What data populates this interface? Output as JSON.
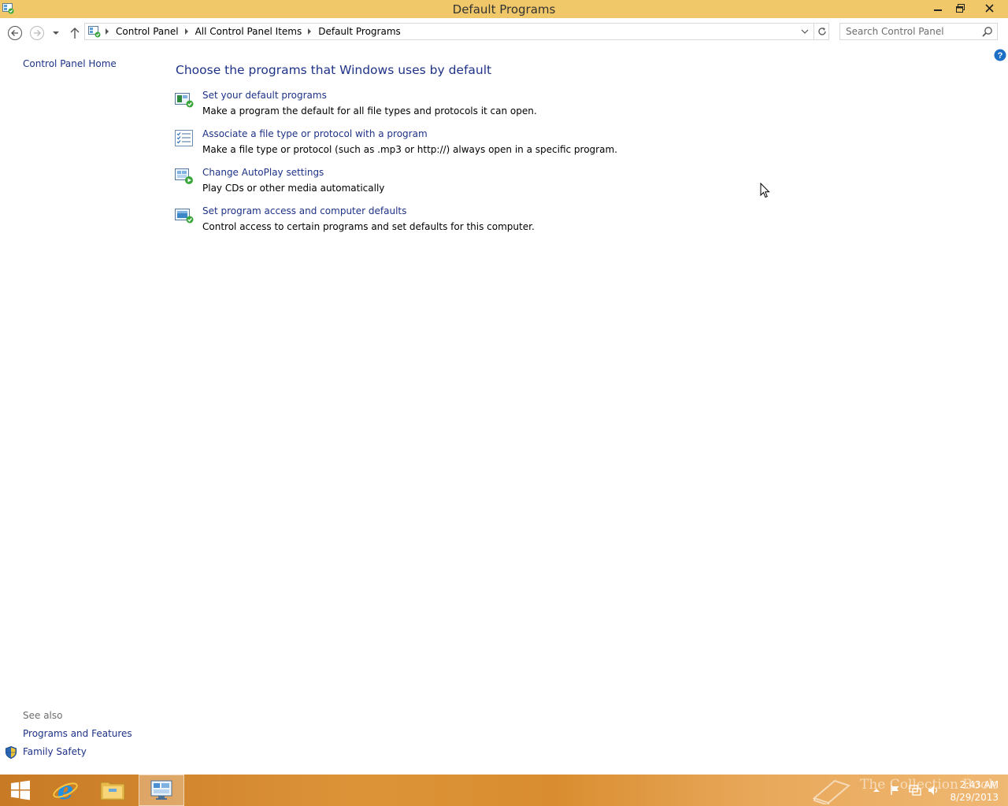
{
  "window": {
    "title": "Default Programs"
  },
  "nav": {
    "breadcrumbs": [
      "Control Panel",
      "All Control Panel Items",
      "Default Programs"
    ],
    "search_placeholder": "Search Control Panel"
  },
  "left_pane": {
    "home_link": "Control Panel Home",
    "see_also_title": "See also",
    "see_also_links": [
      "Programs and Features",
      "Family Safety"
    ]
  },
  "main": {
    "heading": "Choose the programs that Windows uses by default",
    "tasks": [
      {
        "icon": "default-programs-icon",
        "link": "Set your default programs",
        "description": "Make a program the default for all file types and protocols it can open."
      },
      {
        "icon": "file-association-icon",
        "link": "Associate a file type or protocol with a program",
        "description": "Make a file type or protocol (such as .mp3 or http://) always open in a specific program."
      },
      {
        "icon": "autoplay-icon",
        "link": "Change AutoPlay settings",
        "description": "Play CDs or other media automatically"
      },
      {
        "icon": "program-access-icon",
        "link": "Set program access and computer defaults",
        "description": "Control access to certain programs and set defaults for this computer."
      }
    ]
  },
  "taskbar": {
    "apps": [
      "start-icon",
      "internet-explorer-icon",
      "file-explorer-icon",
      "control-panel-icon"
    ],
    "watermark": "The Collection Book",
    "clock_time": "2:43 AM",
    "clock_date": "8/29/2013"
  },
  "colors": {
    "titlebar": "#f0c869",
    "link": "#1e3287",
    "taskbar": "#dc9338"
  }
}
